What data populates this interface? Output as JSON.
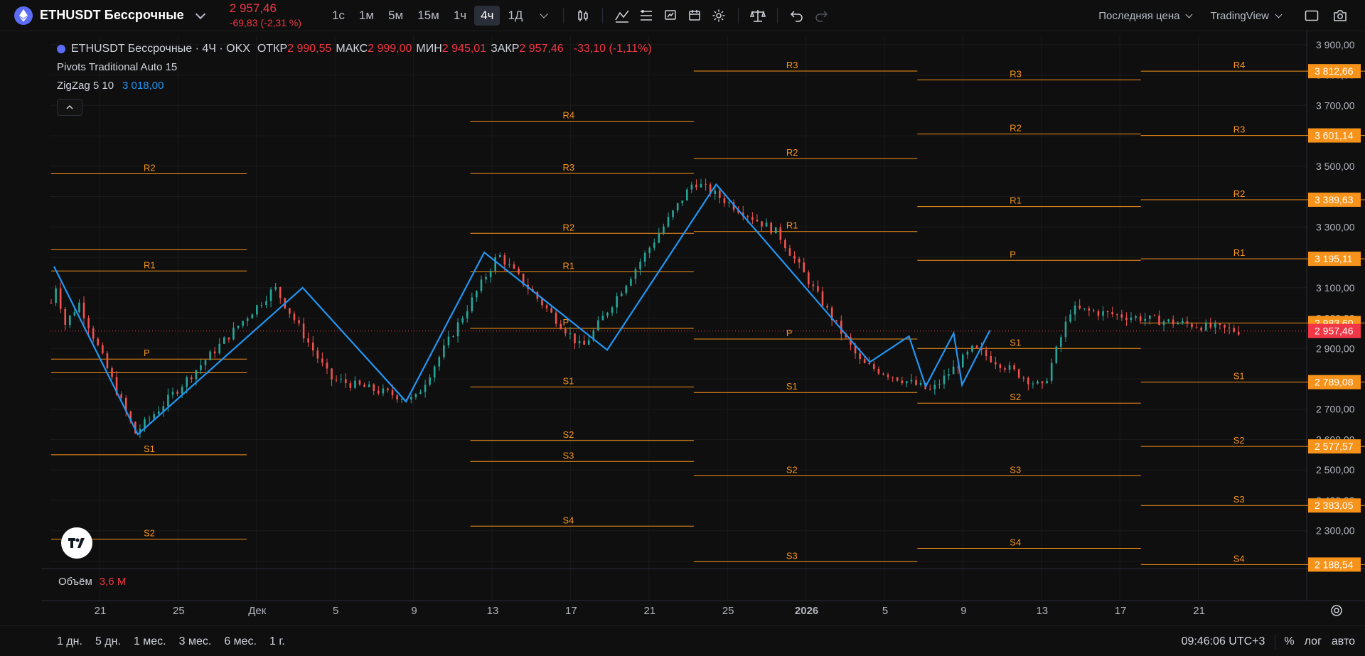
{
  "header": {
    "symbol": "ETHUSDT Бессрочные",
    "price": "2 957,46",
    "change": "-69,83 (-2,31 %)",
    "timeframes": [
      "1с",
      "1м",
      "5м",
      "15м",
      "1ч",
      "4ч",
      "1Д"
    ],
    "active_timeframe": "4ч",
    "price_type": "Последняя цена",
    "chart_provider": "TradingView"
  },
  "legend": {
    "title": "ETHUSDT Бессрочные · 4Ч · OKX",
    "ohlc": [
      {
        "label": "ОТКР",
        "value": "2 990,55"
      },
      {
        "label": "МАКС",
        "value": "2 999,00"
      },
      {
        "label": "МИН",
        "value": "2 945,01"
      },
      {
        "label": "ЗАКР",
        "value": "2 957,46"
      }
    ],
    "change": "-33,10 (-1,11%)",
    "indicator1": "Pivots Traditional Auto 15",
    "indicator2": "ZigZag 5 10",
    "indicator2_value": "3 018,00",
    "volume_label": "Объём",
    "volume_value": "3,6 M"
  },
  "price_axis": {
    "ticks": [
      "3 900,00",
      "3 800,00",
      "3 700,00",
      "3 600,00",
      "3 500,00",
      "3 400,00",
      "3 300,00",
      "3 200,00",
      "3 100,00",
      "3 000,00",
      "2 900,00",
      "2 800,00",
      "2 700,00",
      "2 600,00",
      "2 500,00",
      "2 400,00",
      "2 300,00",
      "2 200,00"
    ],
    "tick_values": [
      3900,
      3800,
      3700,
      3600,
      3500,
      3400,
      3300,
      3200,
      3100,
      3000,
      2900,
      2800,
      2700,
      2600,
      2500,
      2400,
      2300,
      2200
    ],
    "labels": [
      {
        "text": "3 812,66",
        "value": 3812.66,
        "color": "#f7931a"
      },
      {
        "text": "3 601,14",
        "value": 3601.14,
        "color": "#f7931a"
      },
      {
        "text": "3 389,63",
        "value": 3389.63,
        "color": "#f7931a"
      },
      {
        "text": "3 195,11",
        "value": 3195.11,
        "color": "#f7931a"
      },
      {
        "text": "2 983,60",
        "value": 2983.6,
        "color": "#f7931a"
      },
      {
        "text": "2 957,46",
        "value": 2957.46,
        "color": "#f23645"
      },
      {
        "text": "2 789,08",
        "value": 2789.08,
        "color": "#f7931a"
      },
      {
        "text": "2 577,57",
        "value": 2577.57,
        "color": "#f7931a"
      },
      {
        "text": "2 383,05",
        "value": 2383.05,
        "color": "#f7931a"
      },
      {
        "text": "2 188,54",
        "value": 2188.54,
        "color": "#f7931a"
      }
    ]
  },
  "time_axis": {
    "labels": [
      "21",
      "25",
      "Дек",
      "5",
      "9",
      "13",
      "17",
      "21",
      "25",
      "2026",
      "5",
      "9",
      "13",
      "17",
      "21"
    ]
  },
  "bottom": {
    "ranges": [
      "1 дн.",
      "5 дн.",
      "1 мес.",
      "3 мес.",
      "6 мес.",
      "1 г."
    ],
    "clock": "09:46:06 UTC+3",
    "percent": "%",
    "log": "лог",
    "auto": "авто"
  },
  "chart_data": {
    "type": "candlestick",
    "series": [
      {
        "name": "ETHUSDT Бессрочные",
        "approx_path": [
          [
            0,
            3050
          ],
          [
            0.05,
            3150
          ],
          [
            0.5,
            2980
          ],
          [
            1,
            3050
          ],
          [
            3,
            2620
          ],
          [
            8,
            3100
          ],
          [
            10,
            2800
          ],
          [
            13,
            2730
          ],
          [
            16,
            3210
          ],
          [
            19,
            2900
          ],
          [
            23,
            3450
          ],
          [
            26,
            3280
          ],
          [
            29,
            2850
          ],
          [
            31.5,
            2760
          ],
          [
            33,
            2900
          ],
          [
            35.5,
            2770
          ],
          [
            36.5,
            3030
          ],
          [
            42.5,
            2957.46
          ]
        ]
      },
      {
        "name": "ZigZag 5 10",
        "points": [
          [
            0.1,
            3170
          ],
          [
            3.1,
            2617
          ],
          [
            9,
            3100
          ],
          [
            12.7,
            2725
          ],
          [
            15.5,
            3216
          ],
          [
            19.9,
            2895
          ],
          [
            23.8,
            3440
          ],
          [
            29.3,
            2855
          ],
          [
            30.7,
            2940
          ],
          [
            31.3,
            2775
          ],
          [
            32.3,
            2950
          ],
          [
            32.6,
            2780
          ],
          [
            33.6,
            2960
          ]
        ]
      }
    ],
    "pivots": [
      {
        "x0": 0,
        "x1": 7,
        "levels": [
          {
            "label": "R2",
            "value": 3475
          },
          {
            "label": "",
            "value": 3225
          },
          {
            "label": "R1",
            "value": 3155
          },
          {
            "label": "P",
            "value": 2865
          },
          {
            "label": "",
            "value": 2820
          },
          {
            "label": "S1",
            "value": 2550
          },
          {
            "label": "S2",
            "value": 2272
          }
        ]
      },
      {
        "x0": 15,
        "x1": 23,
        "levels": [
          {
            "label": "R4",
            "value": 3648
          },
          {
            "label": "R3",
            "value": 3476
          },
          {
            "label": "R2",
            "value": 3279
          },
          {
            "label": "R1",
            "value": 3152
          },
          {
            "label": "P",
            "value": 2966
          },
          {
            "label": "S1",
            "value": 2773
          },
          {
            "label": "S2",
            "value": 2597
          },
          {
            "label": "S3",
            "value": 2528
          },
          {
            "label": "S4",
            "value": 2315
          }
        ]
      },
      {
        "x0": 23,
        "x1": 31,
        "levels": [
          {
            "label": "R3",
            "value": 3813
          },
          {
            "label": "R2",
            "value": 3525
          },
          {
            "label": "R1",
            "value": 3285
          },
          {
            "label": "P",
            "value": 2931
          },
          {
            "label": "S1",
            "value": 2755
          },
          {
            "label": "S2",
            "value": 2481
          },
          {
            "label": "S3",
            "value": 2198
          }
        ]
      },
      {
        "x0": 31,
        "x1": 39,
        "levels": [
          {
            "label": "R3",
            "value": 3784
          },
          {
            "label": "R2",
            "value": 3606
          },
          {
            "label": "R1",
            "value": 3367
          },
          {
            "label": "P",
            "value": 3190
          },
          {
            "label": "S1",
            "value": 2900
          },
          {
            "label": "S2",
            "value": 2720
          },
          {
            "label": "S3",
            "value": 2481
          },
          {
            "label": "S4",
            "value": 2242
          }
        ]
      },
      {
        "x0": 39,
        "x1": 48,
        "levels": [
          {
            "label": "R4",
            "value": 3812.66
          },
          {
            "label": "R3",
            "value": 3601.14
          },
          {
            "label": "R2",
            "value": 3389.63
          },
          {
            "label": "R1",
            "value": 3195.11
          },
          {
            "label": "",
            "value": 2983.6
          },
          {
            "label": "S1",
            "value": 2789.08
          },
          {
            "label": "S2",
            "value": 2577.57
          },
          {
            "label": "S3",
            "value": 2383.05
          },
          {
            "label": "S4",
            "value": 2188.54
          }
        ]
      }
    ],
    "ylim": [
      2180,
      3930
    ],
    "grid": true
  },
  "colors": {
    "up": "#26a69a",
    "down": "#ef5350",
    "zigzag": "#2196f3",
    "pivot": "#f7931a",
    "accent": "#5b6df6"
  }
}
